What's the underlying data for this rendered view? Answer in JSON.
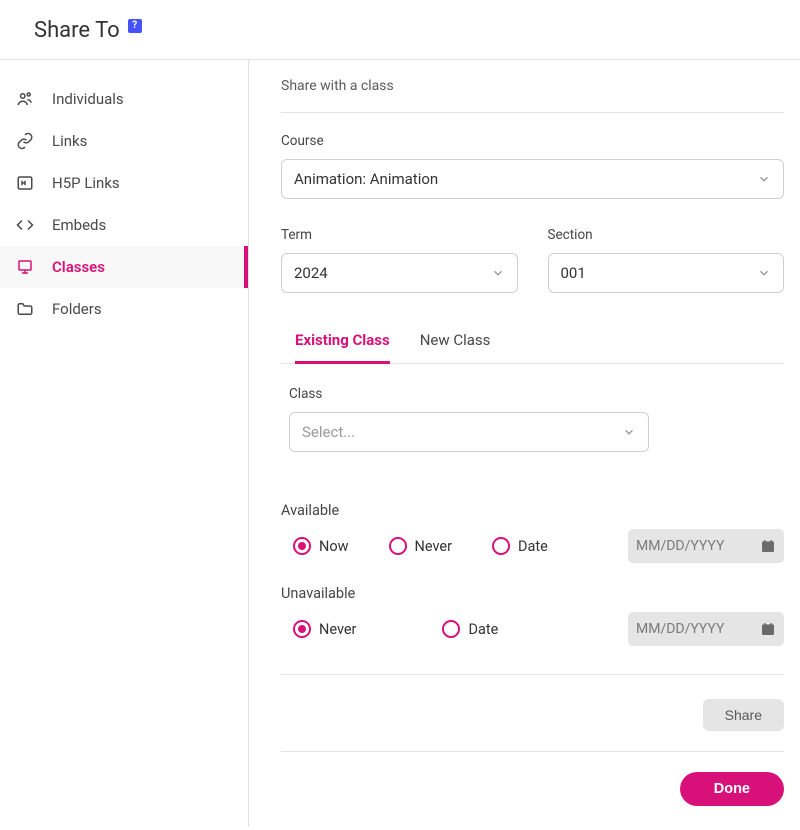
{
  "header": {
    "title": "Share To",
    "help": "?"
  },
  "sidebar": {
    "items": [
      {
        "label": "Individuals"
      },
      {
        "label": "Links"
      },
      {
        "label": "H5P Links"
      },
      {
        "label": "Embeds"
      },
      {
        "label": "Classes"
      },
      {
        "label": "Folders"
      }
    ]
  },
  "main": {
    "subtitle": "Share with a class",
    "course_label": "Course",
    "course_value": "Animation: Animation",
    "term_label": "Term",
    "term_value": "2024",
    "section_label": "Section",
    "section_value": "001",
    "tabs": {
      "existing": "Existing Class",
      "newclass": "New Class"
    },
    "class_label": "Class",
    "class_placeholder": "Select...",
    "available_label": "Available",
    "unavailable_label": "Unavailable",
    "radio_now": "Now",
    "radio_never": "Never",
    "radio_date": "Date",
    "date_placeholder": "MM/DD/YYYY",
    "share_button": "Share",
    "done_button": "Done"
  }
}
